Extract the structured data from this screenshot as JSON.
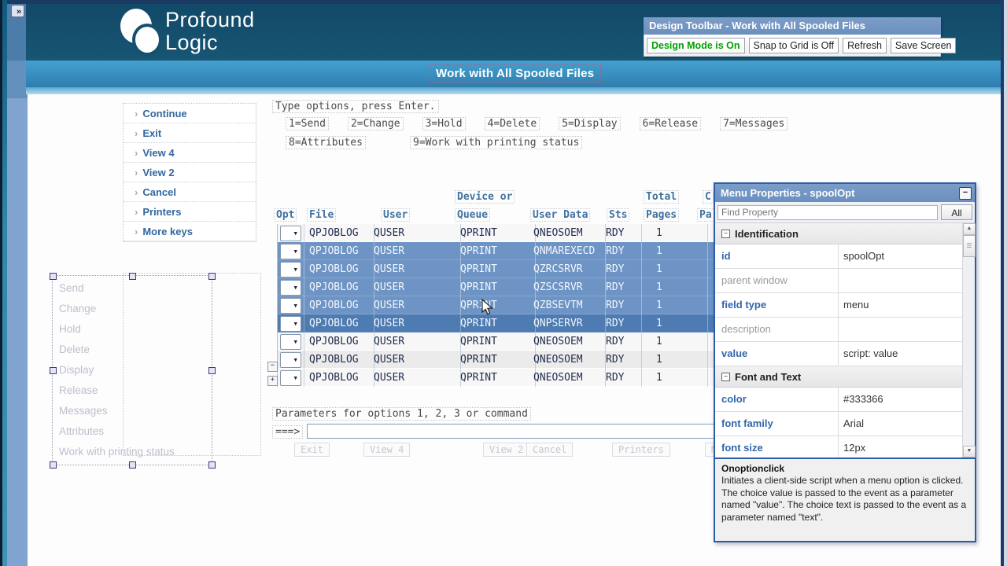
{
  "header": {
    "expand_button": "»",
    "logo_line1": "Profound",
    "logo_line2": "Logic",
    "screen_title": "Work with All Spooled Files"
  },
  "design_toolbar": {
    "title": "Design Toolbar - Work with All Spooled Files",
    "buttons": [
      {
        "label": "Design Mode is On",
        "state": "on"
      },
      {
        "label": "Snap to Grid is Off",
        "state": "off"
      },
      {
        "label": "Refresh",
        "state": "off"
      },
      {
        "label": "Save Screen",
        "state": "off"
      }
    ]
  },
  "function_menu": {
    "items": [
      "Continue",
      "Exit",
      "View 4",
      "View 2",
      "Cancel",
      "Printers",
      "More keys"
    ]
  },
  "instructions": {
    "line1": "Type options, press Enter.",
    "options": [
      "1=Send",
      "2=Change",
      "3=Hold",
      "4=Delete",
      "5=Display",
      "6=Release",
      "7=Messages"
    ],
    "opt8": "8=Attributes",
    "opt9": "9=Work with printing status"
  },
  "grid": {
    "header": {
      "device_top": "Device or",
      "total_top": "Total",
      "cur_top": "C",
      "opt": "Opt",
      "file": "File",
      "user": "User",
      "queue": "Queue",
      "user_data": "User Data",
      "sts": "Sts",
      "pages": "Pages",
      "cur": "Pa"
    },
    "fold_collapse_icon": "−",
    "fold_expand_icon": "+",
    "rows": [
      {
        "file": "QPJOBLOG",
        "user": "QUSER",
        "queue": "QPRINT",
        "user_data": "QNEOSOEM",
        "sts": "RDY",
        "pages": "1",
        "state": "normal"
      },
      {
        "file": "QPJOBLOG",
        "user": "QUSER",
        "queue": "QPRINT",
        "user_data": "QNMAREXECD",
        "sts": "RDY",
        "pages": "1",
        "state": "selected"
      },
      {
        "file": "QPJOBLOG",
        "user": "QUSER",
        "queue": "QPRINT",
        "user_data": "QZRCSRVR",
        "sts": "RDY",
        "pages": "1",
        "state": "selected"
      },
      {
        "file": "QPJOBLOG",
        "user": "QUSER",
        "queue": "QPRINT",
        "user_data": "QZSCSRVR",
        "sts": "RDY",
        "pages": "1",
        "state": "selected"
      },
      {
        "file": "QPJOBLOG",
        "user": "QUSER",
        "queue": "QPRINT",
        "user_data": "QZBSEVTM",
        "sts": "RDY",
        "pages": "1",
        "state": "selected"
      },
      {
        "file": "QPJOBLOG",
        "user": "QUSER",
        "queue": "QPRINT",
        "user_data": "QNPSERVR",
        "sts": "RDY",
        "pages": "1",
        "state": "active"
      },
      {
        "file": "QPJOBLOG",
        "user": "QUSER",
        "queue": "QPRINT",
        "user_data": "QNEOSOEM",
        "sts": "RDY",
        "pages": "1",
        "state": "normal"
      },
      {
        "file": "QPJOBLOG",
        "user": "QUSER",
        "queue": "QPRINT",
        "user_data": "QNEOSOEM",
        "sts": "RDY",
        "pages": "1",
        "state": "normal"
      },
      {
        "file": "QPJOBLOG",
        "user": "QUSER",
        "queue": "QPRINT",
        "user_data": "QNEOSOEM",
        "sts": "RDY",
        "pages": "1",
        "state": "normal"
      }
    ]
  },
  "hidden_menu": {
    "items": [
      "Send",
      "Change",
      "Hold",
      "Delete",
      "Display",
      "Release",
      "Messages",
      "Attributes",
      "Work with printing status"
    ]
  },
  "parameters": {
    "label": "Parameters for options 1, 2, 3 or command",
    "prompt": "===>",
    "input_value": ""
  },
  "ghost_buttons": [
    "Exit",
    "View 4",
    "View 2",
    "Cancel",
    "Printers",
    "M"
  ],
  "properties_panel": {
    "title": "Menu Properties - spoolOpt",
    "minimize_icon": "−",
    "search_placeholder": "Find Property",
    "all_button": "All",
    "sections": [
      {
        "name": "Identification",
        "rows": [
          {
            "label": "id",
            "value": "spoolOpt",
            "state": "set"
          },
          {
            "label": "parent window",
            "value": "",
            "state": "unset"
          },
          {
            "label": "field type",
            "value": "menu",
            "state": "set"
          },
          {
            "label": "description",
            "value": "",
            "state": "unset"
          },
          {
            "label": "value",
            "value": "script: value",
            "state": "set"
          }
        ]
      },
      {
        "name": "Font and Text",
        "rows": [
          {
            "label": "color",
            "value": "#333366",
            "state": "set"
          },
          {
            "label": "font family",
            "value": "Arial",
            "state": "set"
          },
          {
            "label": "font size",
            "value": "12px",
            "state": "set"
          }
        ]
      }
    ],
    "help": {
      "title": "Onoptionclick",
      "text": "Initiates a client-side script when a menu option is clicked. The choice value is passed to the event as a parameter named \"value\". The choice text is passed to the event as a parameter named \"text\"."
    }
  },
  "colors": {
    "accent_blue": "#33679f",
    "selected_row": "#6d94c5",
    "active_row": "#4e7bb1",
    "design_mode_on": "#00a000",
    "panel_border": "#2a5ca8"
  }
}
